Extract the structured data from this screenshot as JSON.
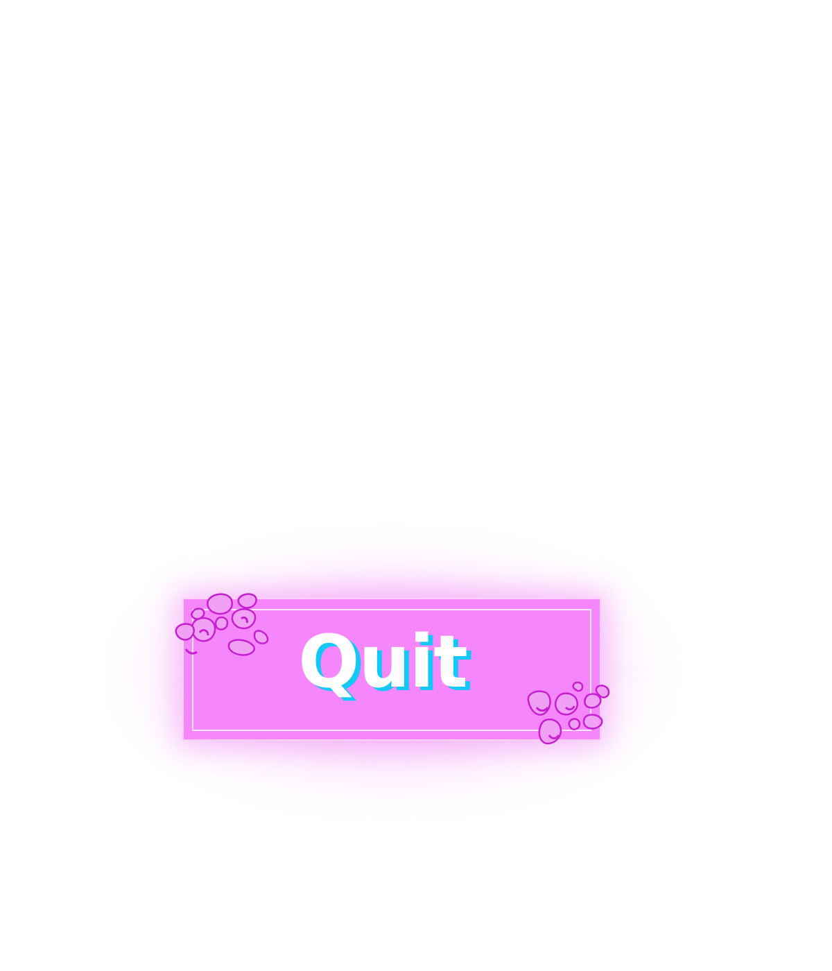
{
  "button": {
    "label": "Quit"
  },
  "colors": {
    "button_fill": "#f586fb",
    "label_color": "#ffffff",
    "label_shadow": "#14c8f5",
    "ornament": "#c51fd0",
    "glow": "#f06ef5"
  },
  "icons": {
    "top_left": "flower-ornament-icon",
    "bottom_right": "flower-ornament-icon"
  }
}
